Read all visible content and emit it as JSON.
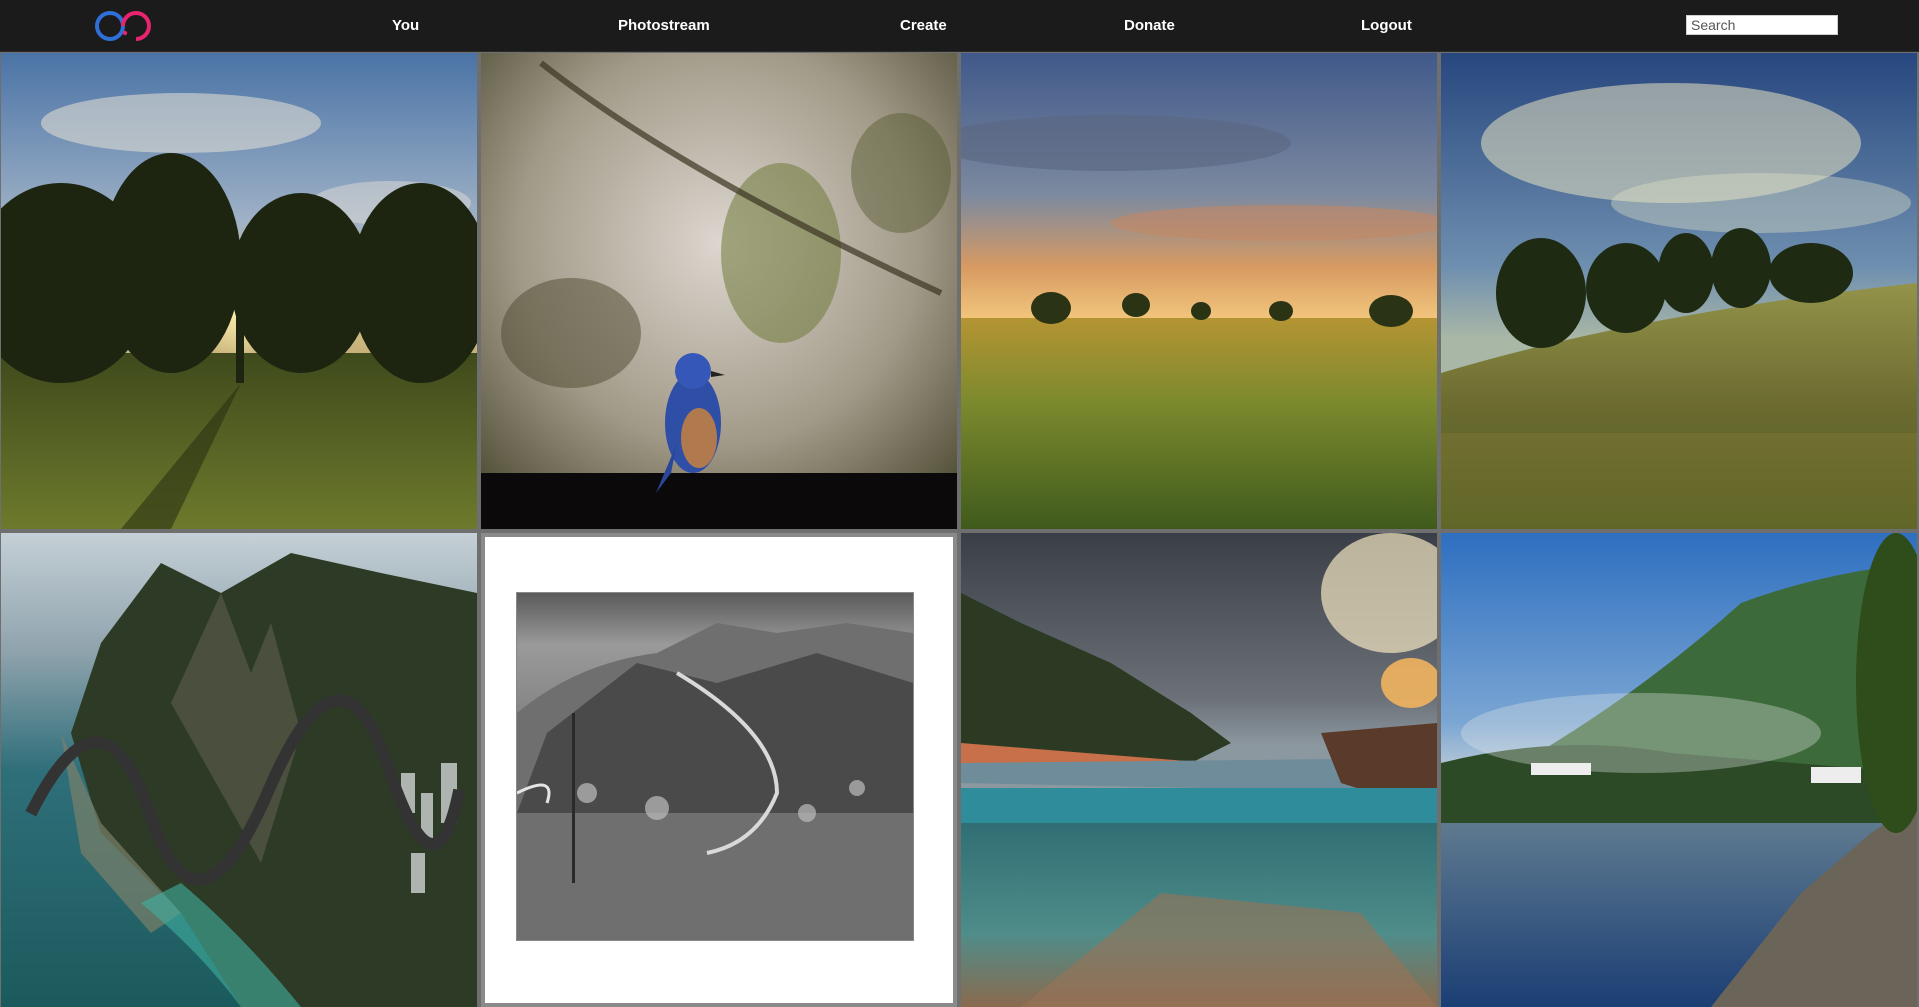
{
  "header": {
    "nav": [
      {
        "label": "You"
      },
      {
        "label": "Photostream"
      },
      {
        "label": "Create"
      },
      {
        "label": "Donate"
      },
      {
        "label": "Logout"
      }
    ],
    "search": {
      "placeholder": "Search",
      "value": ""
    }
  },
  "brand": {
    "colors": {
      "blue": "#2f6fd8",
      "pink": "#e8236f"
    },
    "logo_icon": "infinity-logo-icon"
  },
  "photos": [
    {
      "name": "sunset-trees-meadow"
    },
    {
      "name": "bluebird-on-branch"
    },
    {
      "name": "golden-field-sunset"
    },
    {
      "name": "trees-on-hill-clouds"
    },
    {
      "name": "aerial-coastal-mountains"
    },
    {
      "name": "bw-mountain-road"
    },
    {
      "name": "tidal-pool-storm-clouds"
    },
    {
      "name": "lake-forested-hill"
    }
  ]
}
